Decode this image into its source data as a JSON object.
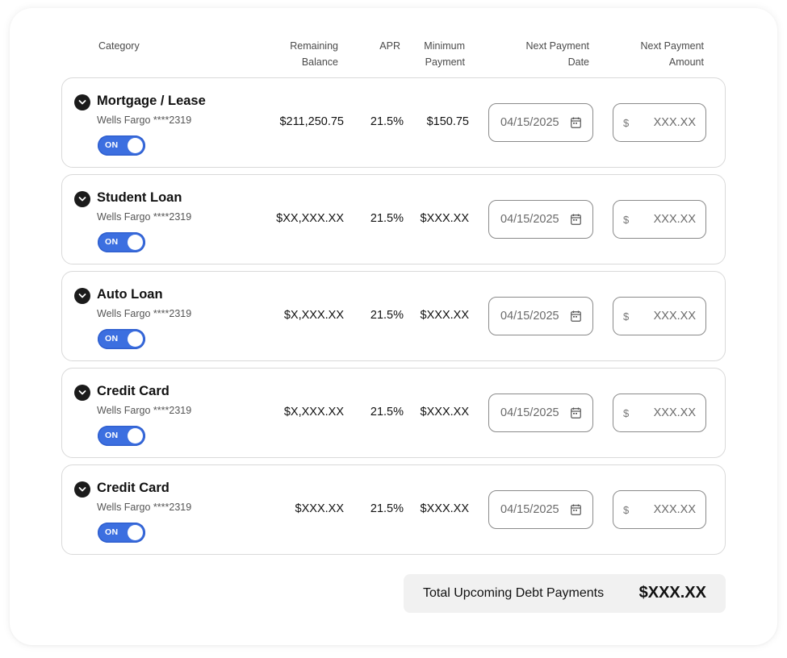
{
  "headers": {
    "category": "Category",
    "remaining_balance": [
      "Remaining",
      "Balance"
    ],
    "apr": "APR",
    "minimum_payment": [
      "Minimum",
      "Payment"
    ],
    "next_payment_date": [
      "Next Payment",
      "Date"
    ],
    "next_payment_amount": [
      "Next Payment",
      "Amount"
    ]
  },
  "colors": {
    "toggle_on": "#3c6fe0",
    "total_bg": "#f1f1f1",
    "row_border": "#d9d9d9"
  },
  "icons": {
    "expand": "chevron-down-icon",
    "date": "calendar-icon"
  },
  "rows": [
    {
      "title": "Mortgage / Lease",
      "account": "Wells Fargo ****2319",
      "toggle": "ON",
      "balance": "$211,250.75",
      "apr": "21.5%",
      "min_payment": "$150.75",
      "date": "04/15/2025",
      "currency": "$",
      "amount_placeholder": "XXX.XX"
    },
    {
      "title": "Student Loan",
      "account": "Wells Fargo ****2319",
      "toggle": "ON",
      "balance": "$XX,XXX.XX",
      "apr": "21.5%",
      "min_payment": "$XXX.XX",
      "date": "04/15/2025",
      "currency": "$",
      "amount_placeholder": "XXX.XX"
    },
    {
      "title": "Auto Loan",
      "account": "Wells Fargo ****2319",
      "toggle": "ON",
      "balance": "$X,XXX.XX",
      "apr": "21.5%",
      "min_payment": "$XXX.XX",
      "date": "04/15/2025",
      "currency": "$",
      "amount_placeholder": "XXX.XX"
    },
    {
      "title": "Credit Card",
      "account": "Wells Fargo ****2319",
      "toggle": "ON",
      "balance": "$X,XXX.XX",
      "apr": "21.5%",
      "min_payment": "$XXX.XX",
      "date": "04/15/2025",
      "currency": "$",
      "amount_placeholder": "XXX.XX"
    },
    {
      "title": "Credit Card",
      "account": "Wells Fargo ****2319",
      "toggle": "ON",
      "balance": "$XXX.XX",
      "apr": "21.5%",
      "min_payment": "$XXX.XX",
      "date": "04/15/2025",
      "currency": "$",
      "amount_placeholder": "XXX.XX"
    }
  ],
  "total": {
    "label": "Total Upcoming Debt Payments",
    "value": "$XXX.XX"
  }
}
